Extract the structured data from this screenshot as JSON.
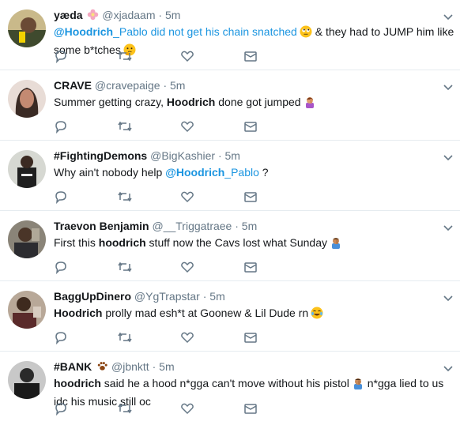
{
  "tweets": [
    {
      "fullname": "yæda",
      "handle": "@xjadaam",
      "dot": "·",
      "time": "5m",
      "segments": [
        {
          "t": "@Hoodrich",
          "s": "mention-bold"
        },
        {
          "t": "_Pablo did not get his chain snatched",
          "s": "mention"
        }
      ],
      "segments2": [
        {
          "t": " & they had to JUMP him like some b*tches",
          "s": ""
        }
      ],
      "avatar_color": "#3f4a2e"
    },
    {
      "fullname": "CRAVE",
      "handle": "@cravepaige",
      "dot": "·",
      "time": "5m",
      "segments": [
        {
          "t": "Summer getting crazy, ",
          "s": ""
        },
        {
          "t": "Hoodrich",
          "s": "bold"
        },
        {
          "t": " done got jumped",
          "s": ""
        }
      ],
      "avatar_color": "#9a6a5a"
    },
    {
      "fullname": "#FightingDemons",
      "handle": "@BigKashier",
      "dot": "·",
      "time": "5m",
      "segments": [
        {
          "t": "Why ain't nobody help ",
          "s": ""
        },
        {
          "t": "@Hoodrich",
          "s": "mention-bold"
        },
        {
          "t": "_Pablo",
          "s": "mention"
        },
        {
          "t": " ?",
          "s": ""
        }
      ],
      "avatar_color": "#5b5b55"
    },
    {
      "fullname": "Traevon Benjamin",
      "handle": "@__Triggatraee",
      "dot": "·",
      "time": "5m",
      "segments": [
        {
          "t": "First this ",
          "s": ""
        },
        {
          "t": "hoodrich",
          "s": "bold"
        },
        {
          "t": " stuff now the Cavs lost what Sunday",
          "s": ""
        }
      ],
      "avatar_color": "#4a4036"
    },
    {
      "fullname": "BaggUpDinero",
      "handle": "@YgTrapstar",
      "dot": "·",
      "time": "5m",
      "segments": [
        {
          "t": "Hoodrich",
          "s": "bold"
        },
        {
          "t": " prolly mad esh*t at Goonew & Lil Dude rn",
          "s": ""
        }
      ],
      "avatar_color": "#6b5040"
    },
    {
      "fullname": "#BANK",
      "handle": "@jbnktt",
      "dot": "·",
      "time": "5m",
      "segments": [
        {
          "t": "hoodrich",
          "s": "bold"
        },
        {
          "t": " said he a hood n*gga can't move without his pistol",
          "s": ""
        }
      ],
      "segments2": [
        {
          "t": " n*gga lied to us idc his music still oc",
          "s": ""
        }
      ],
      "avatar_color": "#2e2e2e"
    }
  ]
}
